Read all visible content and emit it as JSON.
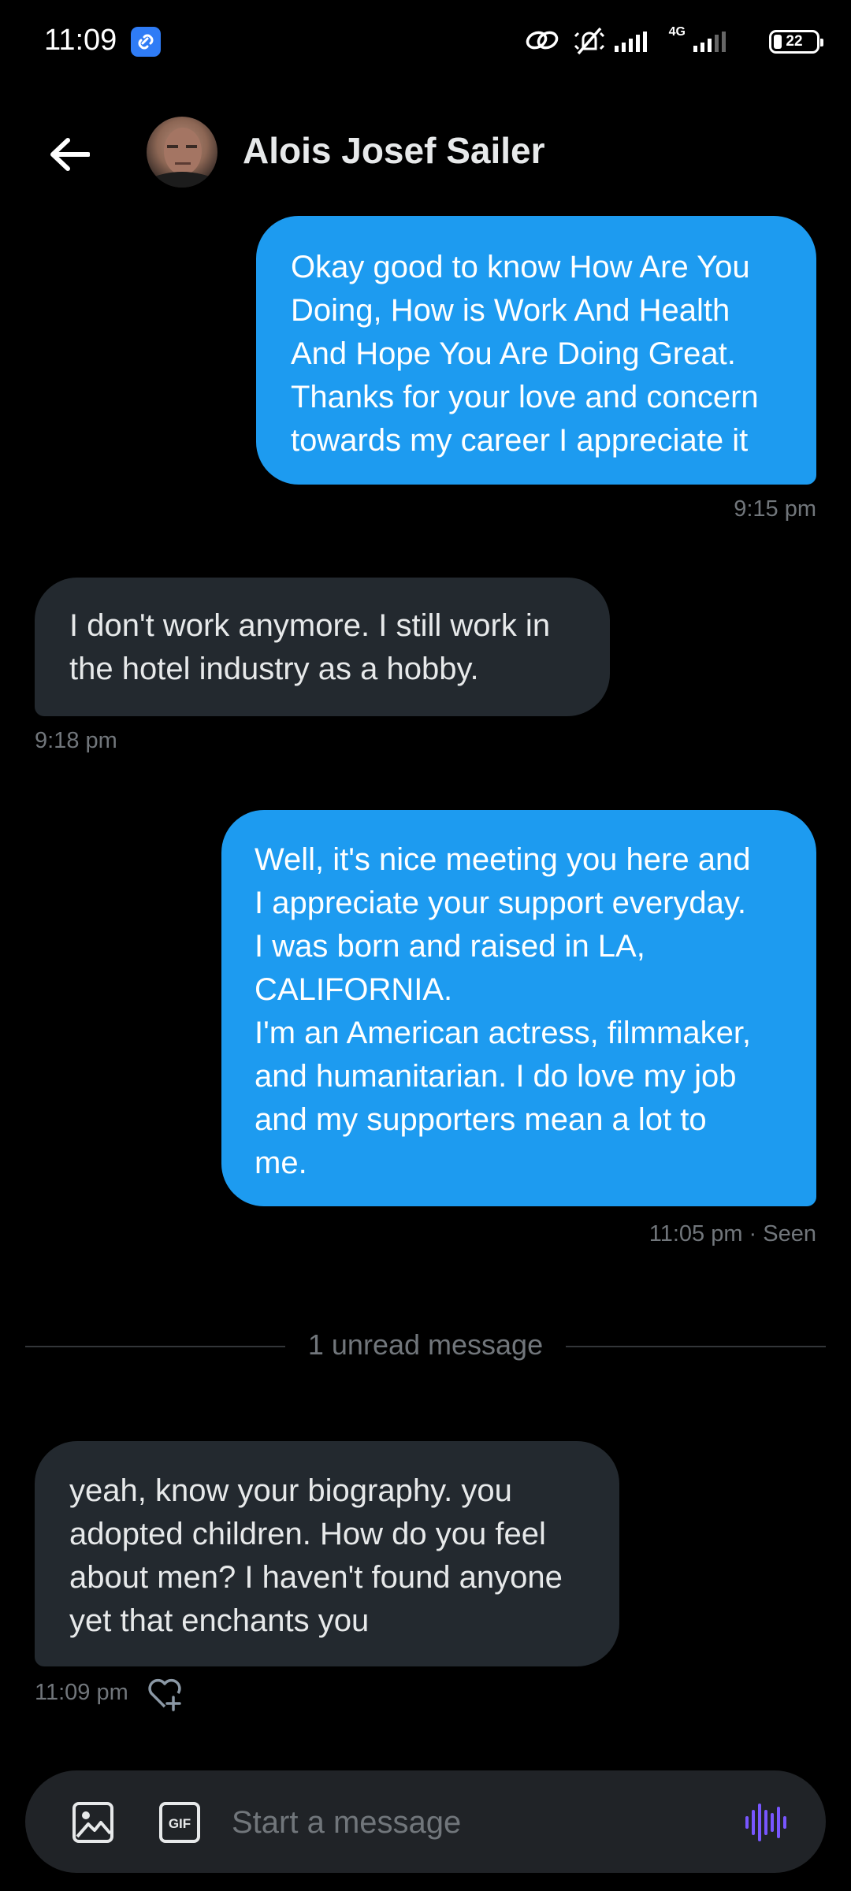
{
  "status_bar": {
    "time": "11:09",
    "network": "4G",
    "battery": "22"
  },
  "header": {
    "contact_name": "Alois Josef Sailer"
  },
  "messages": [
    {
      "direction": "sent",
      "text": "Okay good to know How Are You\nDoing, How is Work And Health\nAnd Hope You Are Doing Great.\nThanks for your love and concern\ntowards my career I appreciate it",
      "meta": "9:15 pm"
    },
    {
      "direction": "received",
      "text": "I don't work anymore. I still work in\nthe hotel industry as a hobby.",
      "meta": "9:18 pm"
    },
    {
      "direction": "sent",
      "text": "Well, it's nice meeting you here and\nI appreciate your support everyday.\nI was born and raised in LA,\nCALIFORNIA.\nI'm an American actress, filmmaker,\nand humanitarian. I  do love my job\nand my supporters mean a lot to\nme.",
      "meta": "11:05 pm · Seen"
    },
    {
      "direction": "received",
      "text": "yeah, know your biography. you\nadopted children. How do you feel\nabout men? I haven't found anyone\nyet that enchants you",
      "meta": "11:09 pm"
    }
  ],
  "unread_divider": "1 unread message",
  "composer": {
    "placeholder": "Start a message"
  },
  "icons": {
    "back": "back-arrow-icon",
    "like": "heart-plus-icon",
    "image": "image-icon",
    "gif": "gif-icon",
    "voice": "voice-wave-icon"
  },
  "colors": {
    "background": "#000000",
    "sent_bubble": "#1d9bf0",
    "received_bubble": "#23292f",
    "meta_text": "#71767b",
    "voice_accent": "#7856ff"
  }
}
